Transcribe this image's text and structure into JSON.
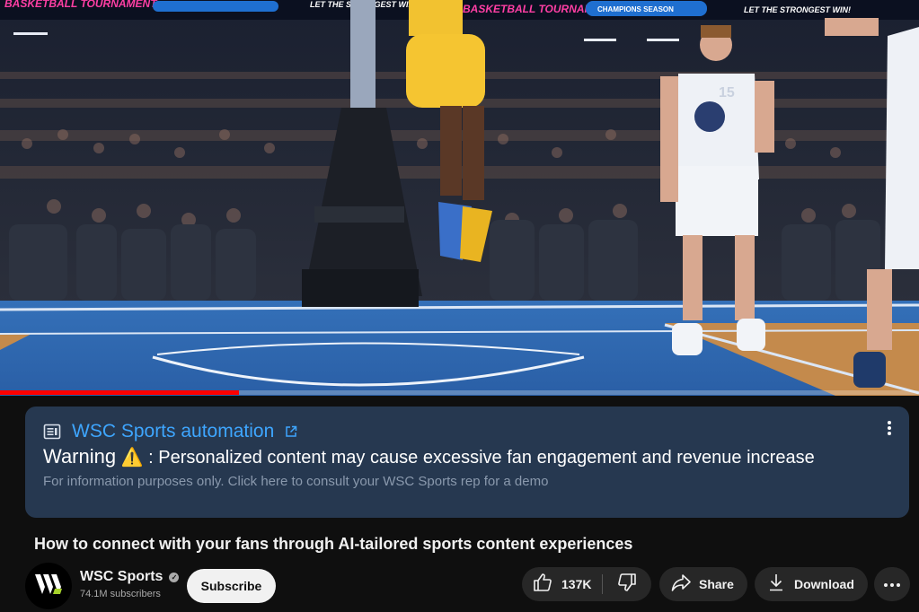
{
  "video": {
    "banners": [
      "BASKETBALL TOURNAMENT",
      "CHAMPIONS SEASON",
      "LET THE STRONGEST WIN!"
    ],
    "jersey_number": "15",
    "progress": 0.26
  },
  "panel": {
    "title": "WSC Sports automation",
    "warning_word": "Warning",
    "warning_glyph": "⚠️",
    "warning_text": ": Personalized content may cause excessive fan engagement and revenue increase",
    "subtext": "For information purposes only. Click here to consult your WSC Sports rep for a demo",
    "icons": {
      "leading": "article-icon",
      "title_suffix": "external-link-icon",
      "menu": "more-vert-icon"
    }
  },
  "video_title": "How to connect with your fans through AI-tailored sports content experiences",
  "channel": {
    "name": "WSC Sports",
    "subscribers": "74.1M subscribers",
    "subscribe_label": "Subscribe",
    "avatar_icon": "wsc-logo-icon"
  },
  "actions": {
    "like_count": "137K",
    "share_label": "Share",
    "download_label": "Download"
  },
  "colors": {
    "accent_link": "#3ea6ff",
    "panel_bg": "#263850",
    "progress": "#ff0000",
    "court": "#2f6db8"
  }
}
